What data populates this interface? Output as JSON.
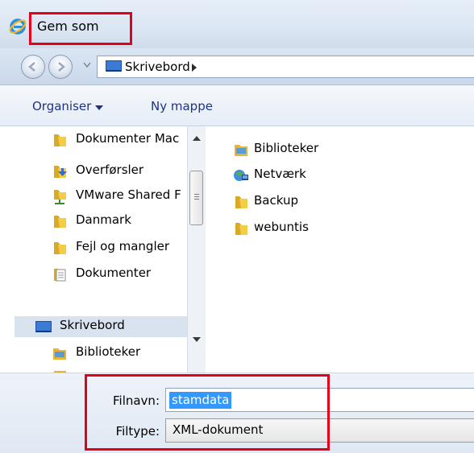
{
  "window": {
    "title": "Gem som"
  },
  "addressbar": {
    "crumb": "Skrivebord"
  },
  "toolbar": {
    "organise_label": "Organiser",
    "new_folder_label": "Ny mappe"
  },
  "navpane": {
    "items": [
      {
        "label": "Dokumenter Mac",
        "icon": "folder-icon"
      },
      {
        "label": "Overførsler",
        "icon": "downloads-folder-icon"
      },
      {
        "label": "VMware Shared F",
        "icon": "network-folder-icon"
      },
      {
        "label": "Danmark",
        "icon": "folder-icon"
      },
      {
        "label": "Fejl og mangler",
        "icon": "folder-icon"
      },
      {
        "label": "Dokumenter",
        "icon": "documents-icon"
      },
      {
        "label": "Skrivebord",
        "icon": "desktop-icon"
      },
      {
        "label": "Biblioteker",
        "icon": "libraries-icon"
      }
    ]
  },
  "content": {
    "items": [
      {
        "label": "Biblioteker",
        "icon": "libraries-icon"
      },
      {
        "label": "Netværk",
        "icon": "network-icon"
      },
      {
        "label": "Backup",
        "icon": "folder-icon"
      },
      {
        "label": "webuntis",
        "icon": "folder-icon"
      }
    ]
  },
  "form": {
    "filename_label": "Filnavn:",
    "filename_value": "stamdata",
    "filetype_label": "Filtype:",
    "filetype_value": "XML-dokument"
  },
  "colors": {
    "highlight_box": "#e2001a",
    "selection": "#3399ff",
    "link_blue": "#1e3287"
  }
}
